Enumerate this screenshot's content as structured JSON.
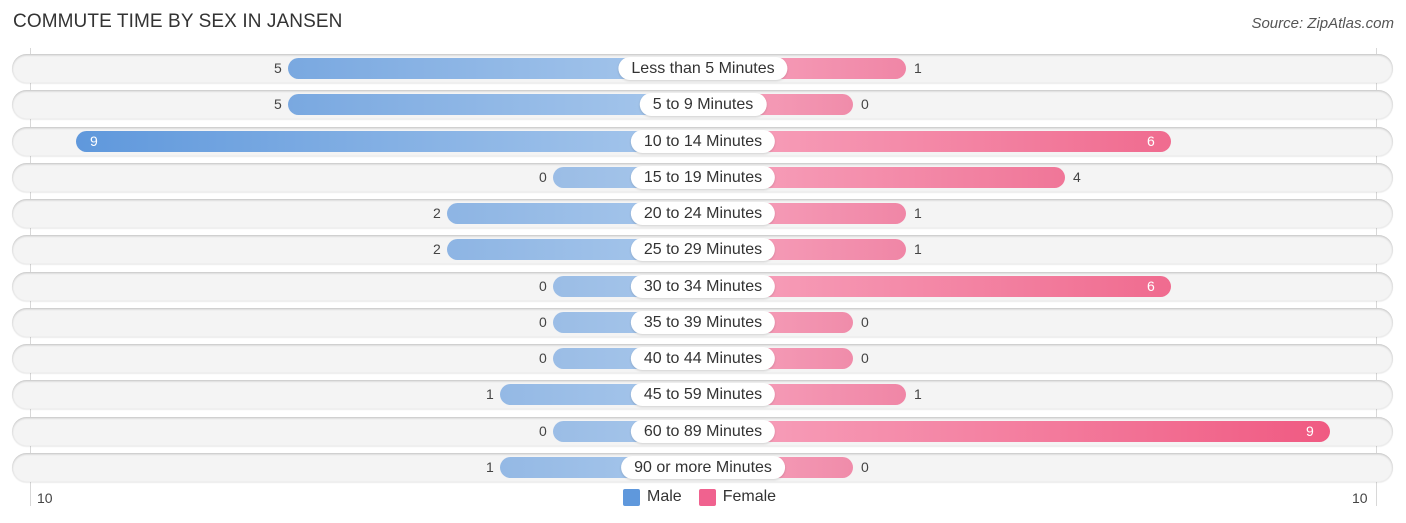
{
  "chart_data": {
    "type": "bar",
    "orientation": "horizontal-diverging",
    "title": "COMMUTE TIME BY SEX IN JANSEN",
    "source": "Source: ZipAtlas.com",
    "categories": [
      "Less than 5 Minutes",
      "5 to 9 Minutes",
      "10 to 14 Minutes",
      "15 to 19 Minutes",
      "20 to 24 Minutes",
      "25 to 29 Minutes",
      "30 to 34 Minutes",
      "35 to 39 Minutes",
      "40 to 44 Minutes",
      "45 to 59 Minutes",
      "60 to 89 Minutes",
      "90 or more Minutes"
    ],
    "series": [
      {
        "name": "Male",
        "color": "#6a9fdc",
        "values": [
          5,
          5,
          9,
          0,
          2,
          2,
          0,
          0,
          0,
          1,
          0,
          1
        ]
      },
      {
        "name": "Female",
        "color": "#f0799f",
        "values": [
          1,
          0,
          6,
          4,
          1,
          1,
          6,
          0,
          0,
          1,
          9,
          0
        ]
      }
    ],
    "axis": {
      "left_label": "10",
      "right_label": "10",
      "max": 10
    },
    "legend": {
      "position": "bottom-center",
      "entries": [
        "Male",
        "Female"
      ]
    },
    "grid": true
  }
}
